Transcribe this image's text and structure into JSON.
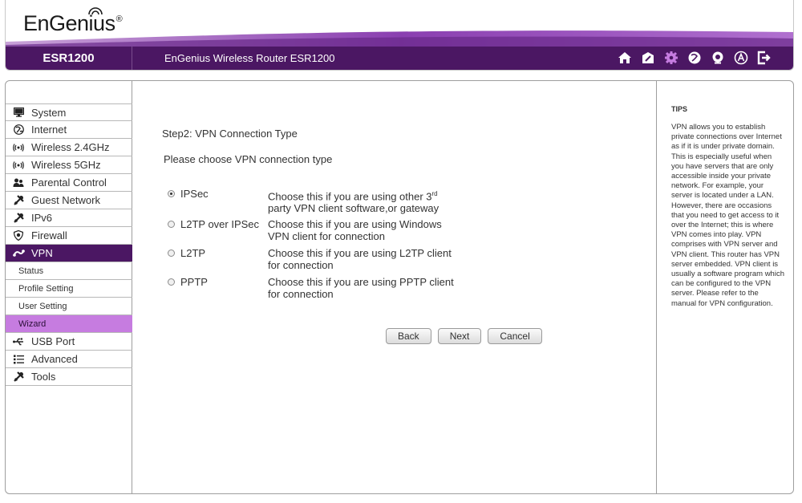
{
  "brand": {
    "name": "EnGenius",
    "reg": "®",
    "color": "#4b1763"
  },
  "topbar": {
    "model": "ESR1200",
    "product": "EnGenius Wireless Router ESR1200",
    "icons": [
      "home-icon",
      "wizard-icon",
      "settings-icon",
      "language-icon",
      "webcam-icon",
      "account-icon",
      "logout-icon"
    ]
  },
  "sidebar": {
    "items": [
      {
        "label": "System",
        "icon": "monitor-icon"
      },
      {
        "label": "Internet",
        "icon": "globe-icon"
      },
      {
        "label": "Wireless 2.4GHz",
        "icon": "wireless-icon"
      },
      {
        "label": "Wireless 5GHz",
        "icon": "wireless-icon"
      },
      {
        "label": "Parental Control",
        "icon": "people-icon"
      },
      {
        "label": "Guest Network",
        "icon": "tools-icon"
      },
      {
        "label": "IPv6",
        "icon": "tools-icon"
      },
      {
        "label": "Firewall",
        "icon": "shield-icon"
      },
      {
        "label": "VPN",
        "icon": "vpn-icon"
      }
    ],
    "vpn_sub": [
      {
        "label": "Status"
      },
      {
        "label": "Profile Setting"
      },
      {
        "label": "User Setting"
      },
      {
        "label": "Wizard"
      }
    ],
    "items_after": [
      {
        "label": "USB Port",
        "icon": "usb-icon"
      },
      {
        "label": "Advanced",
        "icon": "list-icon"
      },
      {
        "label": "Tools",
        "icon": "tools-icon"
      }
    ]
  },
  "main": {
    "step": "Step2: VPN Connection Type",
    "prompt": "Please choose VPN connection type",
    "options": [
      {
        "name": "IPSec",
        "desc1": "Choose this if you are using other 3",
        "sup": "rd",
        "desc2": "party VPN client software,or gateway",
        "selected": true
      },
      {
        "name": "L2TP over IPSec",
        "desc1": "Choose this if you are using Windows",
        "desc2": "VPN client for connection",
        "selected": false
      },
      {
        "name": "L2TP",
        "desc1": "Choose this if you are using L2TP client",
        "desc2": "for connection",
        "selected": false
      },
      {
        "name": "PPTP",
        "desc1": "Choose this if you are using PPTP client",
        "desc2": "for connection",
        "selected": false
      }
    ],
    "buttons": {
      "back": "Back",
      "next": "Next",
      "cancel": "Cancel"
    }
  },
  "tips": {
    "title": "TIPS",
    "text": "VPN allows you to establish private connections over Internet as if it is under private domain. This is especially useful when you have servers that are only accessible inside your private network. For example, your server is located under a LAN. However, there are occasions that you need to get access to it over the Internet; this is where VPN comes into play. VPN comprises with VPN server and VPN client. This router has VPN server embedded. VPN client is usually a software program which can be configured to the VPN server. Please refer to the manual for VPN configuration."
  }
}
